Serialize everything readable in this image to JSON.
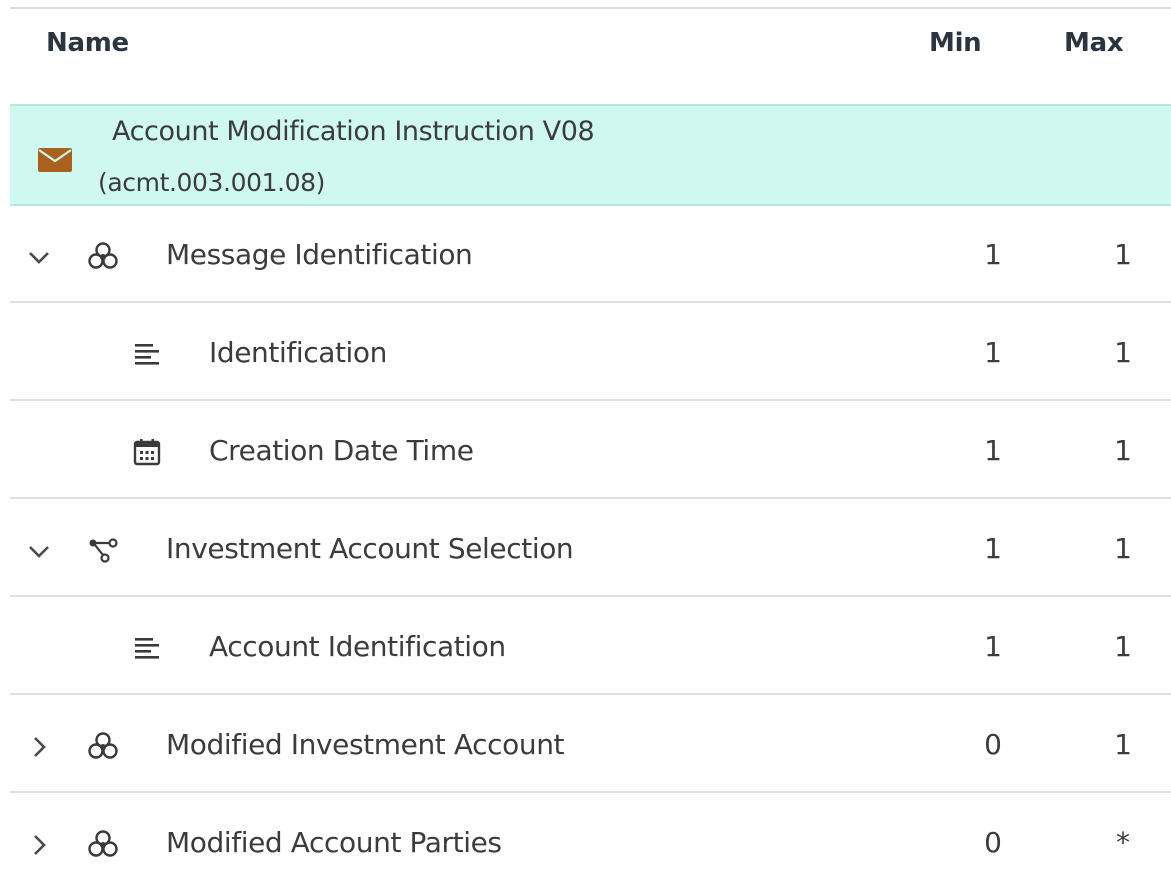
{
  "header": {
    "name_label": "Name",
    "min_label": "Min",
    "max_label": "Max"
  },
  "root": {
    "title": "Account Modification Instruction V08",
    "code": "(acmt.003.001.08)",
    "icon": "envelope-icon",
    "icon_color": "#a9621d",
    "background": "#cef8f0"
  },
  "rows": [
    {
      "label": "Message Identification",
      "min": "1",
      "max": "1",
      "icon": "component-icon",
      "chevron": "expanded",
      "level": 1
    },
    {
      "label": "Identification",
      "min": "1",
      "max": "1",
      "icon": "text-lines-icon",
      "chevron": "none",
      "level": 2
    },
    {
      "label": "Creation Date Time",
      "min": "1",
      "max": "1",
      "icon": "calendar-icon",
      "chevron": "none",
      "level": 2
    },
    {
      "label": "Investment Account Selection",
      "min": "1",
      "max": "1",
      "icon": "choice-icon",
      "chevron": "expanded",
      "level": 1
    },
    {
      "label": "Account Identification",
      "min": "1",
      "max": "1",
      "icon": "text-lines-icon",
      "chevron": "none",
      "level": 2
    },
    {
      "label": "Modified Investment Account",
      "min": "0",
      "max": "1",
      "icon": "component-icon",
      "chevron": "collapsed",
      "level": 1
    },
    {
      "label": "Modified Account Parties",
      "min": "0",
      "max": "*",
      "icon": "component-icon",
      "chevron": "collapsed",
      "level": 1
    }
  ]
}
